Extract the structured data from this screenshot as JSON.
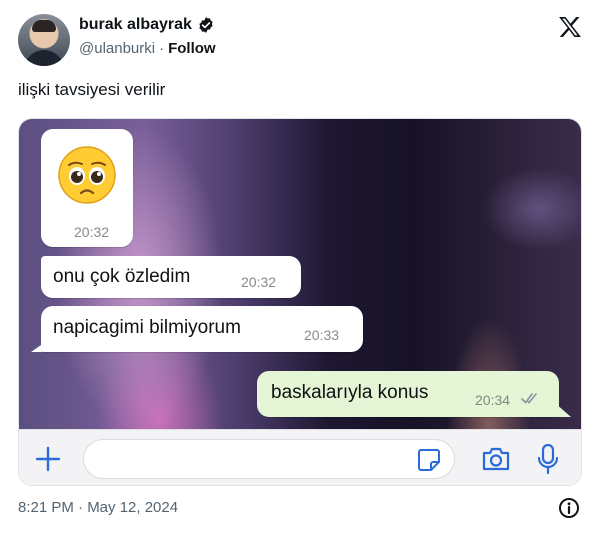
{
  "tweet": {
    "author": {
      "display_name": "burak albayrak",
      "handle": "@ulanburki",
      "separator": "·",
      "follow_label": "Follow",
      "verified": true
    },
    "text": "ilişki tavsiyesi verilir",
    "timestamp": "8:21 PM · May 12, 2024",
    "platform_icon": "x-logo-icon"
  },
  "chat": {
    "messages": [
      {
        "type": "emoji",
        "emoji": "🥺",
        "time": "20:32",
        "direction": "incoming"
      },
      {
        "type": "text",
        "text": "onu çok özledim",
        "time": "20:32",
        "direction": "incoming"
      },
      {
        "type": "text",
        "text": "napicagimi bilmiyorum",
        "time": "20:33",
        "direction": "incoming"
      },
      {
        "type": "text",
        "text": "baskalarıyla konus",
        "time": "20:34",
        "direction": "outgoing",
        "status": "read-double-check"
      }
    ],
    "input_bar": {
      "icons": [
        "plus-icon",
        "sticker-icon",
        "camera-icon",
        "microphone-icon"
      ],
      "placeholder": ""
    },
    "colors": {
      "incoming_bubble": "#ffffff",
      "outgoing_bubble": "#e4f6d5",
      "accent": "#2b6cdb"
    }
  }
}
